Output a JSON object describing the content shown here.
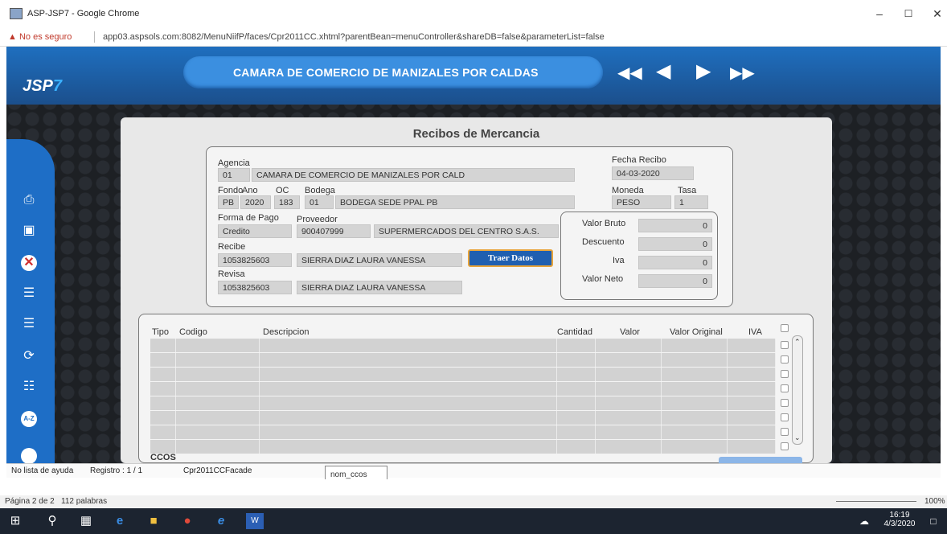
{
  "window": {
    "title": "ASP-JSP7 - Google Chrome"
  },
  "address": {
    "security_label": "No es seguro",
    "url": "app03.aspsols.com:8082/MenuNiifP/faces/Cpr2011CC.xhtml?parentBean=menuController&shareDB=false&parameterList=false"
  },
  "app": {
    "logo_main": "JSP",
    "logo_num": "7",
    "company": "CAMARA DE COMERCIO DE MANIZALES POR CALDAS",
    "nav_icons": [
      "first-record-icon",
      "previous-record-icon",
      "next-record-icon",
      "last-record-icon"
    ]
  },
  "sidebar": {
    "icons": [
      "print-icon",
      "save-icon",
      "delete-icon",
      "add-database-icon",
      "remove-database-icon",
      "refresh-icon",
      "search-document-icon",
      "sort-az-icon",
      "more-icon"
    ]
  },
  "form": {
    "title": "Recibos de Mercancia",
    "agencia_label": "Agencia",
    "agencia_code": "01",
    "agencia_name": "CAMARA DE COMERCIO DE MANIZALES POR CALD",
    "fecha_label": "Fecha Recibo",
    "fecha_value": "04-03-2020",
    "fondo_label": "Fondo",
    "fondo_value": "PB",
    "ano_label": "Ano",
    "ano_value": "2020",
    "oc_label": "OC",
    "oc_value": "183",
    "bodega_label": "Bodega",
    "bodega_code": "01",
    "bodega_name": "BODEGA SEDE PPAL PB",
    "moneda_label": "Moneda",
    "moneda_value": "PESO",
    "tasa_label": "Tasa",
    "tasa_value": "1",
    "forma_pago_label": "Forma de Pago",
    "forma_pago_value": "Credito",
    "proveedor_label": "Proveedor",
    "proveedor_nit": "900407999",
    "proveedor_name": "SUPERMERCADOS DEL CENTRO S.A.S.",
    "recibe_label": "Recibe",
    "recibe_id": "1053825603",
    "recibe_name": "SIERRA DIAZ LAURA VANESSA",
    "revisa_label": "Revisa",
    "revisa_id": "1053825603",
    "revisa_name": "SIERRA DIAZ LAURA VANESSA",
    "traer_button": "Traer Datos",
    "valor_bruto_label": "Valor Bruto",
    "valor_bruto": "0",
    "descuento_label": "Descuento",
    "descuento": "0",
    "iva_label": "Iva",
    "iva": "0",
    "valor_neto_label": "Valor Neto",
    "valor_neto": "0"
  },
  "grid": {
    "columns": [
      "Tipo",
      "Codigo",
      "Descripcion",
      "Cantidad",
      "Valor",
      "Valor Original",
      "IVA"
    ],
    "row_count": 8,
    "ccos_label": "CCOS"
  },
  "status": {
    "help": "No lista de ayuda",
    "registro": "Registro : 1 / 1",
    "facade": "Cpr2011CCFacade",
    "tooltip": "nom_ccos"
  },
  "word": {
    "page": "Página 2 de 2",
    "words": "112 palabras",
    "zoom": "100%"
  },
  "taskbar": {
    "time": "16:19",
    "date": "4/3/2020"
  }
}
